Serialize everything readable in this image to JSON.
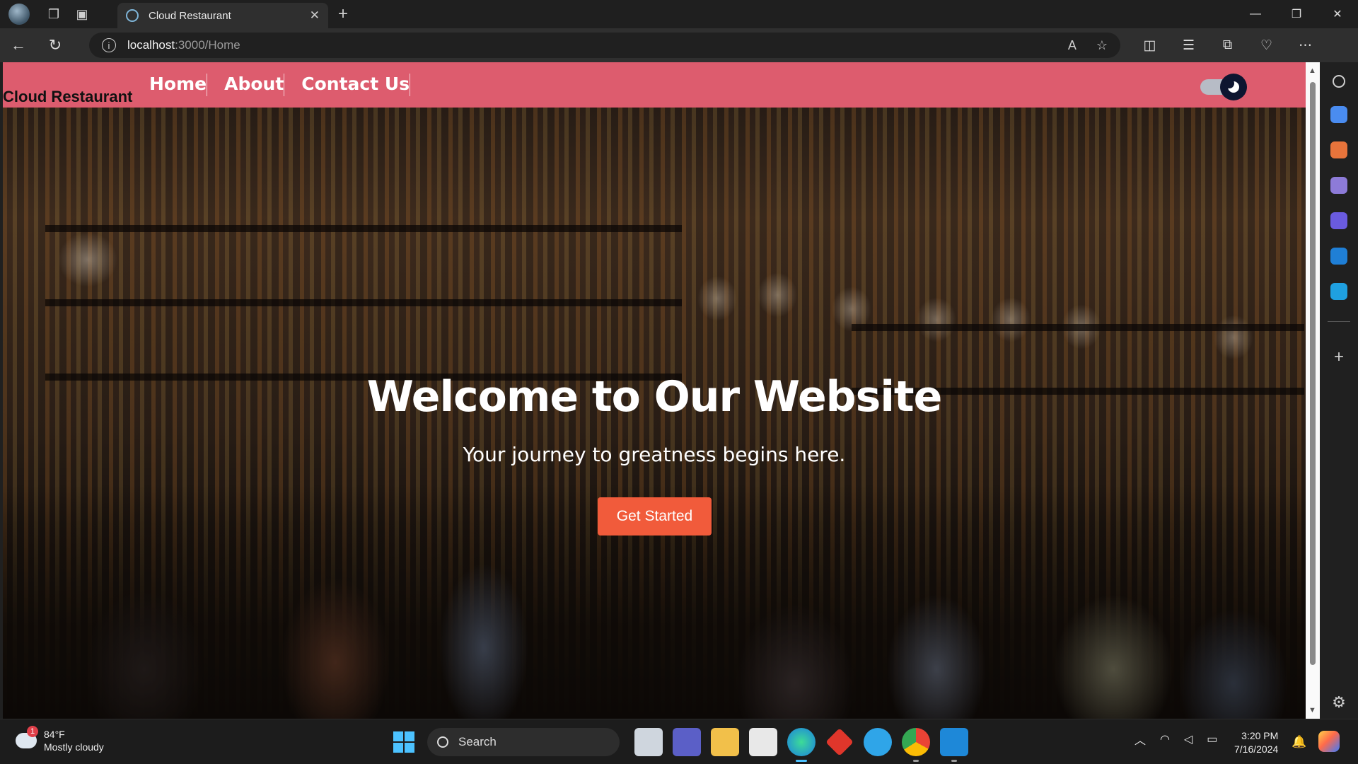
{
  "browser": {
    "tab_title": "Cloud Restaurant",
    "url_host": "localhost",
    "url_path": ":3000/Home"
  },
  "navbar": {
    "brand": "Cloud Restaurant",
    "links": [
      "Home",
      "About",
      "Contact Us"
    ],
    "color": "#dd5c6e"
  },
  "hero": {
    "title": "Welcome to Our Website",
    "subtitle": "Your journey to greatness begins here.",
    "cta_label": "Get Started",
    "cta_color": "#f15b3b"
  },
  "taskbar": {
    "weather_temp": "84°F",
    "weather_condition": "Mostly cloudy",
    "weather_badge": "1",
    "search_label": "Search",
    "time": "3:20 PM",
    "date": "7/16/2024"
  }
}
